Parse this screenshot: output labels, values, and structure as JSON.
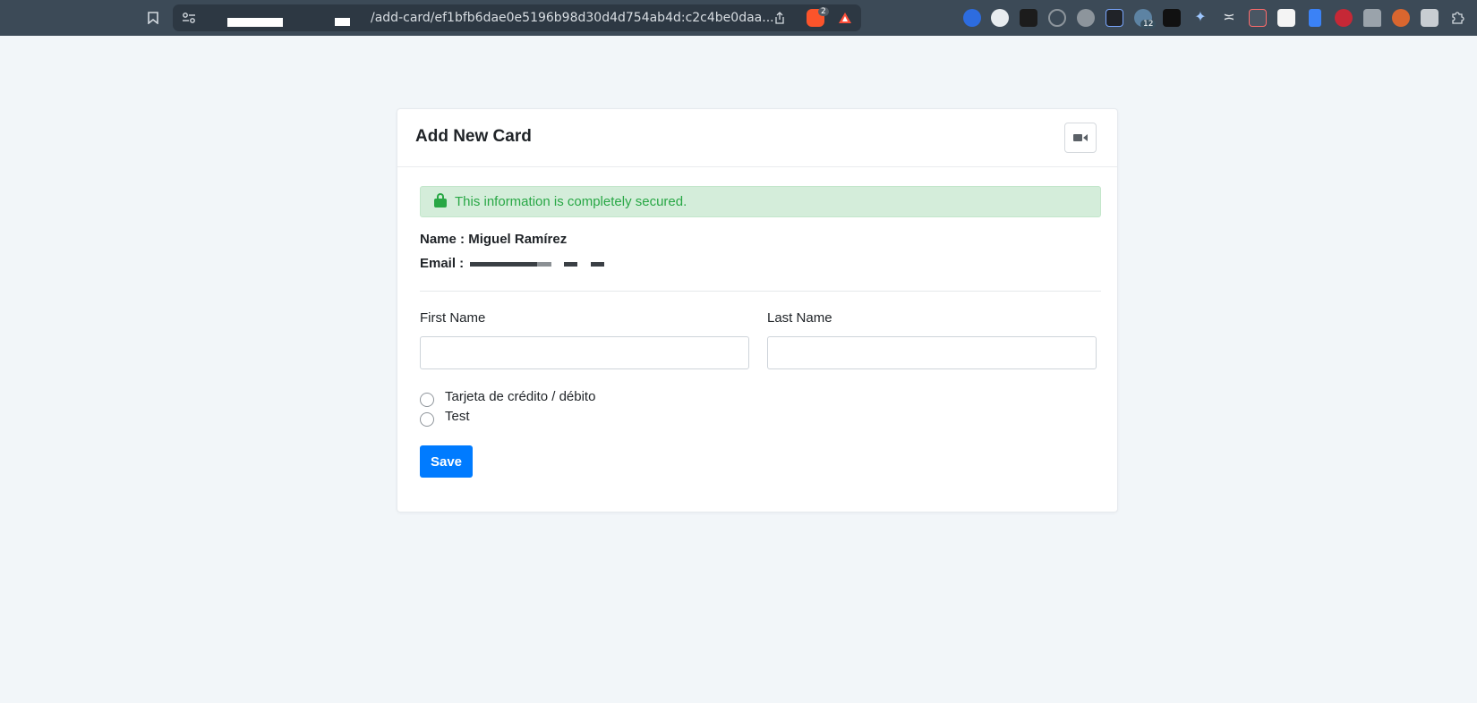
{
  "browser": {
    "url": "/add-card/ef1bfb6dae0e5196b98d30d4d754ab4d:c2c4be0daa...",
    "brave_badge": "2",
    "extension_badge": "12"
  },
  "card": {
    "title": "Add New Card",
    "alert": "This information is completely secured.",
    "name_label": "Name :",
    "name_value": "Miguel Ramírez",
    "email_label": "Email :"
  },
  "form": {
    "first_name_label": "First Name",
    "last_name_label": "Last Name",
    "first_name_value": "",
    "last_name_value": "",
    "payment_options": [
      "Tarjeta de crédito / débito",
      "Test"
    ],
    "save_label": "Save"
  },
  "colors": {
    "primary": "#007bff",
    "success": "#28a745",
    "alert_bg": "#d4edda",
    "page_bg": "#f2f6f9",
    "browser_bar": "#3c4a57"
  },
  "icons": {
    "video_button": "video-camera-icon",
    "alert": "lock-icon"
  }
}
